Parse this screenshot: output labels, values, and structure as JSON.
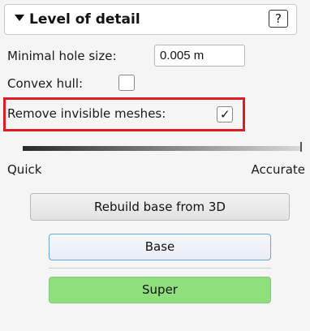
{
  "panel": {
    "title": "Level of detail",
    "help_label": "?"
  },
  "hole": {
    "label": "Minimal hole size:",
    "value": "0.005 m"
  },
  "convex": {
    "label": "Convex hull:",
    "checked": false
  },
  "remove_invisible": {
    "label": "Remove invisible meshes:",
    "checked": true,
    "check_glyph": "✓"
  },
  "slider": {
    "min_label": "Quick",
    "max_label": "Accurate",
    "value": 1.0
  },
  "buttons": {
    "rebuild": "Rebuild base from 3D",
    "base": "Base",
    "super": "Super"
  },
  "colors": {
    "highlight": "#e11b22",
    "super_green": "#8fe07d",
    "base_border": "#6aa6df"
  }
}
